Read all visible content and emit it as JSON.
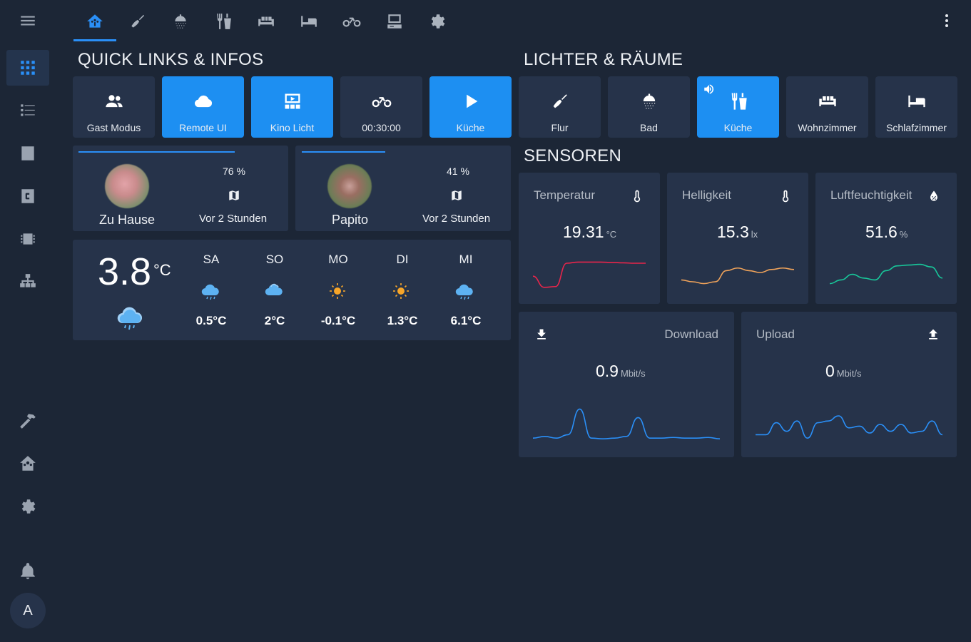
{
  "sidebar": {
    "menu_icon": "menu-icon",
    "items": [
      {
        "icon": "view-grid-icon",
        "active": true
      },
      {
        "icon": "list-icon",
        "active": false
      },
      {
        "icon": "chart-bar-icon",
        "active": false
      },
      {
        "icon": "code-c-icon",
        "active": false
      },
      {
        "icon": "chip-icon",
        "active": false
      },
      {
        "icon": "sitemap-icon",
        "active": false
      },
      {
        "icon": "hammer-icon",
        "active": false
      },
      {
        "icon": "home-assistant-icon",
        "active": false
      },
      {
        "icon": "gear-icon",
        "active": false
      },
      {
        "icon": "bell-icon",
        "active": false
      }
    ],
    "avatar_initial": "A"
  },
  "tabs": [
    {
      "icon": "home-icon",
      "active": true
    },
    {
      "icon": "broom-icon",
      "active": false
    },
    {
      "icon": "shower-icon",
      "active": false
    },
    {
      "icon": "silverware-icon",
      "active": false
    },
    {
      "icon": "sofa-icon",
      "active": false
    },
    {
      "icon": "bed-icon",
      "active": false
    },
    {
      "icon": "bike-icon",
      "active": false
    },
    {
      "icon": "desktop-icon",
      "active": false
    },
    {
      "icon": "gear-icon",
      "active": false
    }
  ],
  "sections": {
    "quick_links": "QUICK LINKS & INFOS",
    "lichter": "LICHTER & RÄUME",
    "sensoren": "SENSOREN"
  },
  "quick_buttons": [
    {
      "label": "Gast Modus",
      "icon": "account-group-icon",
      "on": false
    },
    {
      "label": "Remote UI",
      "icon": "cloud-icon",
      "on": true
    },
    {
      "label": "Kino Licht",
      "icon": "theater-icon",
      "on": true
    },
    {
      "label": "00:30:00",
      "icon": "bike-icon",
      "on": false
    },
    {
      "label": "Küche",
      "icon": "play-icon",
      "on": true
    }
  ],
  "room_buttons": [
    {
      "label": "Flur",
      "icon": "broom-icon",
      "on": false
    },
    {
      "label": "Bad",
      "icon": "shower-icon",
      "on": false
    },
    {
      "label": "Küche",
      "icon": "silverware-icon",
      "on": true,
      "sub_icon": "speaker-icon"
    },
    {
      "label": "Wohnzimmer",
      "icon": "sofa-icon",
      "on": false
    },
    {
      "label": "Schlafzimmer",
      "icon": "bed-icon",
      "on": false
    }
  ],
  "persons": [
    {
      "name": "Zu Hause",
      "battery": "76 %",
      "battery_fraction": 0.76,
      "location_icon": "map-icon",
      "last_seen": "Vor 2 Stunden"
    },
    {
      "name": "Papito",
      "battery": "41 %",
      "battery_fraction": 0.41,
      "location_icon": "map-icon",
      "last_seen": "Vor 2 Stunden"
    }
  ],
  "weather": {
    "current_temp": "3.8",
    "unit": "°C",
    "current_icon": "rainy-cloud-icon",
    "forecast": [
      {
        "day": "SA",
        "icon": "rain-cloud-icon",
        "temp": "0.5°C"
      },
      {
        "day": "SO",
        "icon": "cloud-icon",
        "temp": "2°C"
      },
      {
        "day": "MO",
        "icon": "sun-icon",
        "temp": "-0.1°C"
      },
      {
        "day": "DI",
        "icon": "sun-icon",
        "temp": "1.3°C"
      },
      {
        "day": "MI",
        "icon": "rain-cloud-icon",
        "temp": "6.1°C"
      }
    ]
  },
  "sensors": [
    {
      "name": "Temperatur",
      "value": "19.31",
      "unit": "°C",
      "icon": "thermometer-icon",
      "color": "#e8254b",
      "series": [
        0.4,
        0.1,
        0.12,
        0.75,
        0.78,
        0.78,
        0.78,
        0.77,
        0.76,
        0.75,
        0.75
      ]
    },
    {
      "name": "Helligkeit",
      "value": "15.3",
      "unit": "lx",
      "icon": "thermometer-icon",
      "color": "#f0a35a",
      "series": [
        0.3,
        0.25,
        0.2,
        0.25,
        0.55,
        0.62,
        0.55,
        0.5,
        0.58,
        0.62,
        0.58
      ]
    },
    {
      "name": "Luftfeuchtigkeit",
      "value": "51.6",
      "unit": "%",
      "icon": "water-percent-icon",
      "color": "#18c79a",
      "series": [
        0.2,
        0.3,
        0.45,
        0.35,
        0.3,
        0.55,
        0.68,
        0.7,
        0.72,
        0.65,
        0.35
      ]
    },
    {
      "name": "Download",
      "value": "0.9",
      "unit": "Mbit/s",
      "icon": "download-icon",
      "color": "#2a8ff7",
      "series": [
        0.1,
        0.15,
        0.1,
        0.2,
        0.95,
        0.1,
        0.08,
        0.1,
        0.15,
        0.7,
        0.1,
        0.1,
        0.12,
        0.1,
        0.1,
        0.12,
        0.08
      ]
    },
    {
      "name": "Upload",
      "value": "0",
      "unit": "Mbit/s",
      "icon": "upload-icon",
      "color": "#2a8ff7",
      "series": [
        0.2,
        0.2,
        0.55,
        0.3,
        0.6,
        0.1,
        0.55,
        0.6,
        0.75,
        0.4,
        0.45,
        0.25,
        0.5,
        0.3,
        0.5,
        0.25,
        0.3,
        0.6,
        0.2
      ]
    }
  ]
}
